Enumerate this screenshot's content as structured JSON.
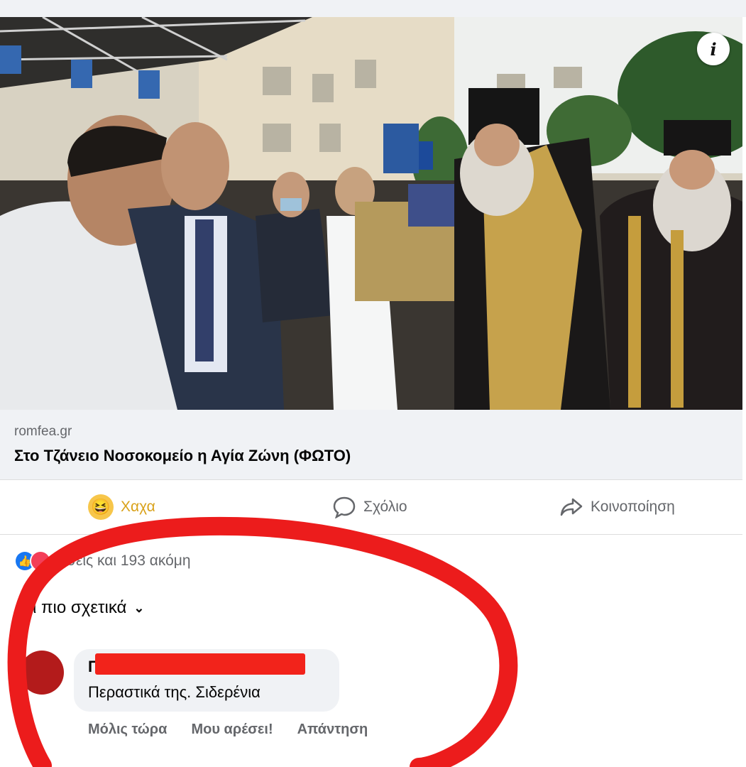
{
  "post": {
    "info_icon": "info-icon",
    "link": {
      "domain": "romfea.gr",
      "title": "Στο Τζάνειο Νοσοκομείο η Αγία Ζώνη (ΦΩΤΟ)"
    }
  },
  "actions": {
    "haha": {
      "label": "Χαχα",
      "icon": "haha-emoji-icon",
      "color": "#d9a21a"
    },
    "comment": {
      "label": "Σχόλιο",
      "icon": "comment-icon"
    },
    "share": {
      "label": "Κοινοποίηση",
      "icon": "share-icon"
    }
  },
  "reactions": {
    "summary": "Εσείς και 193 ακόμη",
    "icons": [
      "like-icon",
      "love-icon"
    ]
  },
  "comments": {
    "sort_label": "ι πιο σχετικά",
    "items": [
      {
        "author_visible": "Π",
        "text": "Περαστικά της. Σιδερένια",
        "time": "Μόλις τώρα",
        "like_label": "Μου αρέσει!",
        "reply_label": "Απάντηση"
      }
    ]
  },
  "colors": {
    "annotation_red": "#ec1c1c",
    "facebook_blue": "#1877f2",
    "muted_text": "#65676b"
  }
}
